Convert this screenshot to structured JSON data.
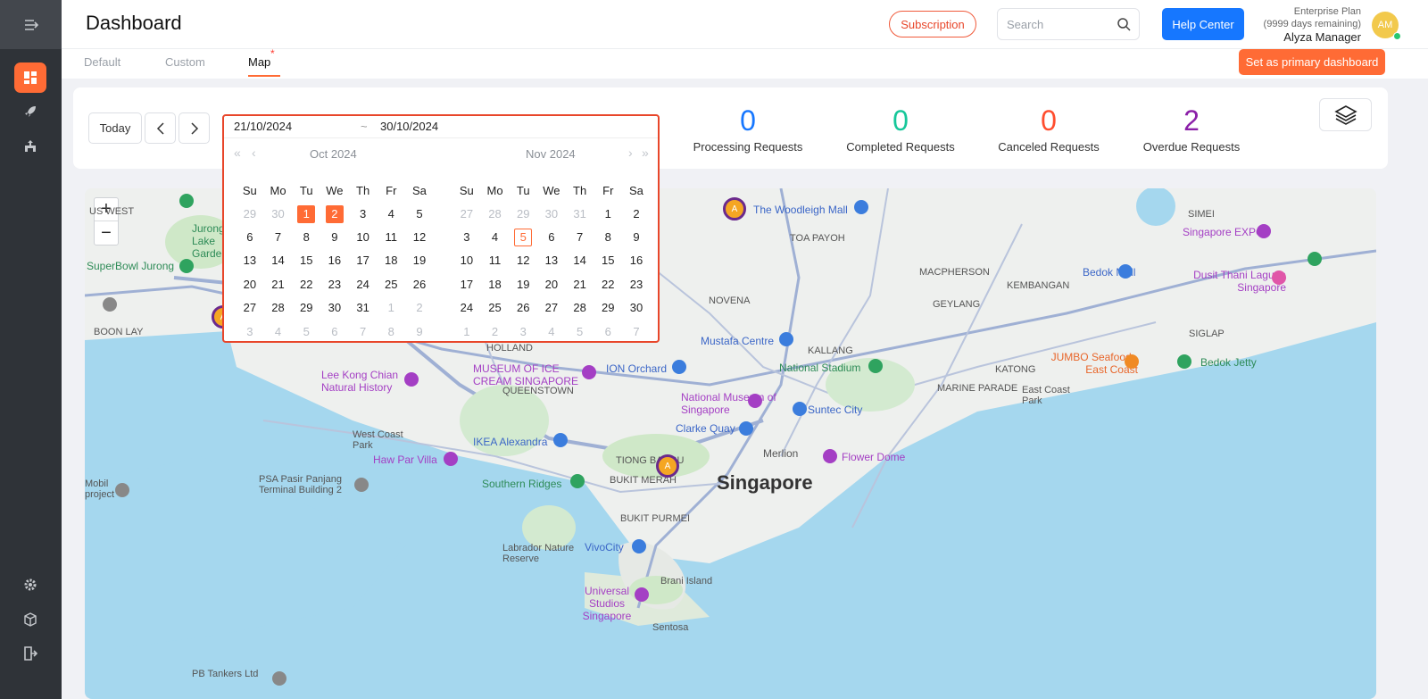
{
  "header": {
    "title": "Dashboard",
    "subscription_label": "Subscription",
    "search_placeholder": "Search",
    "help_label": "Help Center",
    "plan_name": "Enterprise Plan",
    "plan_remaining": "(9999 days remaining)",
    "user_name": "Alyza Manager",
    "avatar_initials": "AM"
  },
  "tabs": [
    {
      "label": "Default"
    },
    {
      "label": "Custom"
    },
    {
      "label": "Map",
      "marker": "*"
    }
  ],
  "primary_button": "Set as primary dashboard",
  "toolbar": {
    "today_label": "Today",
    "start_date": "21/10/2024",
    "separator": "~",
    "end_date": "30/10/2024"
  },
  "stats": [
    {
      "value": "0",
      "label": "Processing Requests",
      "color": "#1677ff"
    },
    {
      "value": "0",
      "label": "Completed Requests",
      "color": "#16c79a"
    },
    {
      "value": "0",
      "label": "Canceled Requests",
      "color": "#ff4d2e"
    },
    {
      "value": "2",
      "label": "Overdue Requests",
      "color": "#8b1fa8"
    }
  ],
  "calendar": {
    "left_title": "Oct 2024",
    "right_title": "Nov 2024",
    "weekdays": [
      "Su",
      "Mo",
      "Tu",
      "We",
      "Th",
      "Fr",
      "Sa"
    ],
    "left_rows": [
      [
        "29",
        "30",
        "1",
        "2",
        "3",
        "4",
        "5"
      ],
      [
        "6",
        "7",
        "8",
        "9",
        "10",
        "11",
        "12"
      ],
      [
        "13",
        "14",
        "15",
        "16",
        "17",
        "18",
        "19"
      ],
      [
        "20",
        "21",
        "22",
        "23",
        "24",
        "25",
        "26"
      ],
      [
        "27",
        "28",
        "29",
        "30",
        "31",
        "1",
        "2"
      ],
      [
        "3",
        "4",
        "5",
        "6",
        "7",
        "8",
        "9"
      ]
    ],
    "right_rows": [
      [
        "27",
        "28",
        "29",
        "30",
        "31",
        "1",
        "2"
      ],
      [
        "3",
        "4",
        "5",
        "6",
        "7",
        "8",
        "9"
      ],
      [
        "10",
        "11",
        "12",
        "13",
        "14",
        "15",
        "16"
      ],
      [
        "17",
        "18",
        "19",
        "20",
        "21",
        "22",
        "23"
      ],
      [
        "24",
        "25",
        "26",
        "27",
        "28",
        "29",
        "30"
      ],
      [
        "1",
        "2",
        "3",
        "4",
        "5",
        "6",
        "7"
      ]
    ]
  },
  "map": {
    "zoom_in": "+",
    "zoom_out": "−",
    "city_label": "Singapore",
    "marker_letter": "A",
    "labels": {
      "west": "US WEST",
      "toa_payoh": "TOA PAYOH",
      "simei": "SIMEI",
      "macpherson": "MACPHERSON",
      "kembangan": "KEMBANGAN",
      "novena": "NOVENA",
      "geylang": "GEYLANG",
      "kallang": "KALLANG",
      "siglap": "SIGLAP",
      "katong": "KATONG",
      "marine_parade": "MARINE PARADE",
      "boon_lay": "BOON LAY",
      "holland": "HOLLAND",
      "queenstown": "QUEENSTOWN",
      "west_coast_park": "West Coast Park",
      "tiong_bahru": "TIONG BAHRU",
      "bukit_merah": "BUKIT MERAH",
      "bukit_purmei": "BUKIT PURMEI",
      "lab_nature": "Labrador Nature Reserve",
      "brani": "Brani Island",
      "sentosa": "Sentosa",
      "east_coast_park": "East Coast Park",
      "pasir_panjang": "PSA Pasir Panjang Terminal Building 2",
      "mobil": "Mobil project",
      "pb_tankers": "PB Tankers Ltd",
      "jurong_lake": "Jurong Lake Gardens",
      "superbowl": "SuperBowl Jurong",
      "woodleigh": "The Woodleigh Mall",
      "expo": "Singapore EXPO",
      "bedok_mall": "Bedok Mall",
      "dusit": "Dusit Thani Laguna Singapore",
      "mustafa": "Mustafa Centre",
      "stadium": "National Stadium",
      "jumbo": "JUMBO Seafood - East Coast",
      "bedok_jetty": "Bedok Jetty",
      "lee_kong": "Lee Kong Chian Natural History",
      "moi": "MUSEUM OF ICE CREAM SINGAPORE",
      "ion": "ION Orchard",
      "national_museum": "National Museum of Singapore",
      "suntec": "Suntec City",
      "clarke": "Clarke Quay",
      "ikea": "IKEA Alexandra",
      "haw_par": "Haw Par Villa",
      "southern_ridges": "Southern Ridges",
      "merlion": "Merlion",
      "flower_dome": "Flower Dome",
      "vivocity": "VivoCity",
      "uss": "Universal Studios Singapore"
    }
  }
}
